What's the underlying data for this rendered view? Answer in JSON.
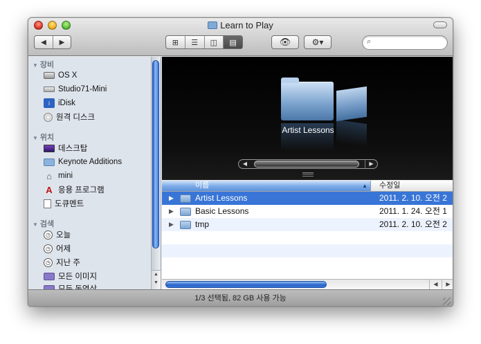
{
  "window": {
    "title": "Learn to Play"
  },
  "toolbar": {
    "back_icon": "◀",
    "forward_icon": "▶",
    "view_icons": [
      "⊞",
      "☰",
      "◫",
      "▤"
    ],
    "active_view_index": 3,
    "quicklook_icon": "👁",
    "action_icon": "⚙▾",
    "search": {
      "value": "",
      "placeholder": "",
      "icon": "⌕"
    }
  },
  "sidebar": {
    "sections": [
      {
        "label": "장비",
        "items": [
          {
            "label": "OS X",
            "icon": "hard-disk-icon"
          },
          {
            "label": "Studio71-Mini",
            "icon": "external-drive-icon"
          },
          {
            "label": "iDisk",
            "icon": "idisk-icon"
          },
          {
            "label": "원격 디스크",
            "icon": "remote-disc-icon"
          }
        ]
      },
      {
        "label": "위치",
        "items": [
          {
            "label": "데스크탑",
            "icon": "desktop-icon"
          },
          {
            "label": "Keynote Additions",
            "icon": "folder-icon"
          },
          {
            "label": "mini",
            "icon": "home-icon"
          },
          {
            "label": "응용 프로그램",
            "icon": "applications-icon"
          },
          {
            "label": "도큐멘트",
            "icon": "documents-icon"
          }
        ]
      },
      {
        "label": "검색",
        "items": [
          {
            "label": "오늘",
            "icon": "clock-icon"
          },
          {
            "label": "어제",
            "icon": "clock-icon"
          },
          {
            "label": "지난 주",
            "icon": "clock-icon"
          },
          {
            "label": "모든 이미지",
            "icon": "smart-folder-icon"
          },
          {
            "label": "모든 동영상",
            "icon": "smart-folder-icon"
          }
        ]
      }
    ]
  },
  "coverflow": {
    "selected_label": "Artist Lessons"
  },
  "list": {
    "columns": {
      "name": "이름",
      "date": "수정일"
    },
    "rows": [
      {
        "name": "Artist Lessons",
        "date": "2011. 2. 10. 오전 2",
        "selected": true
      },
      {
        "name": "Basic Lessons",
        "date": "2011. 1. 24. 오전 1",
        "selected": false
      },
      {
        "name": "tmp",
        "date": "2011. 2. 10. 오전 2",
        "selected": false
      }
    ]
  },
  "status": {
    "text": "1/3 선택됨, 82 GB 사용 가능"
  }
}
